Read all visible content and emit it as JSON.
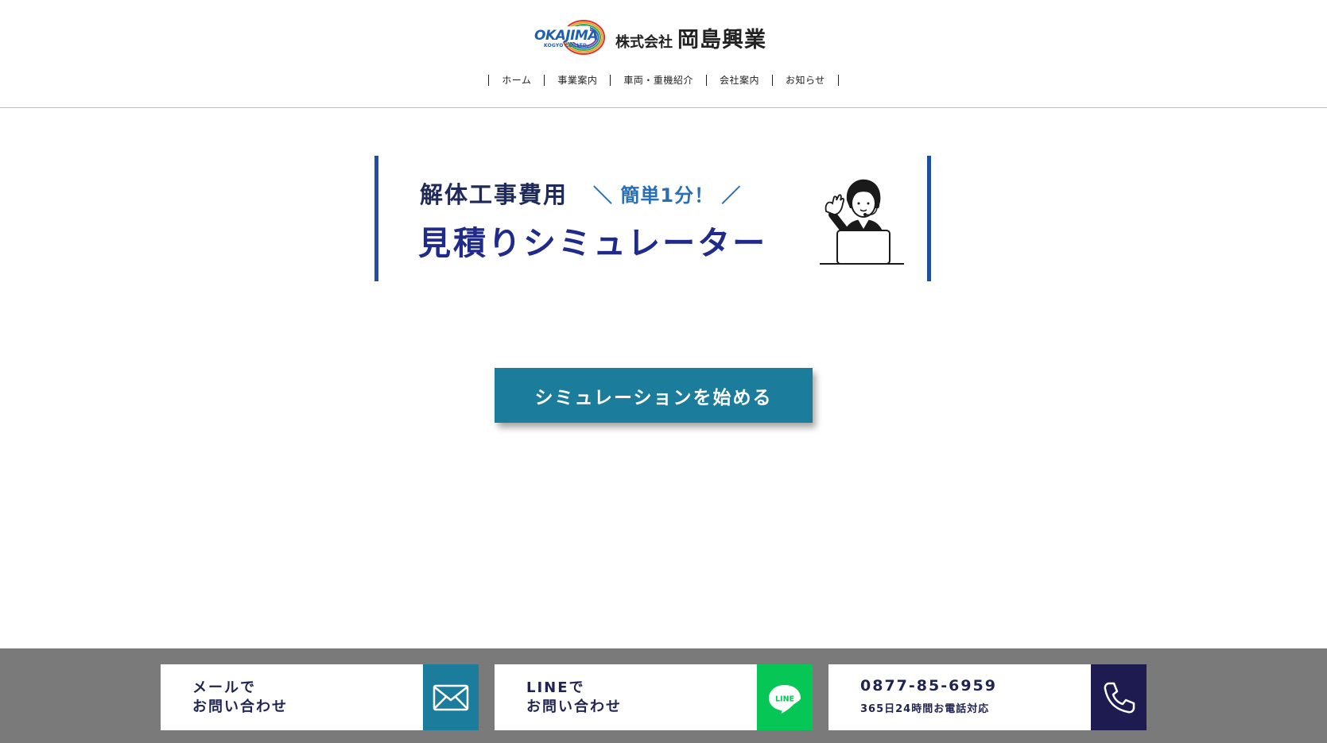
{
  "header": {
    "logo": {
      "wordmark": "OKAJIMA",
      "submark": "KOGYO CO.,LTD.",
      "prefix": "株式会社",
      "name": "岡島興業"
    },
    "nav": [
      {
        "label": "ホーム"
      },
      {
        "label": "事業案内"
      },
      {
        "label": "車両・重機紹介"
      },
      {
        "label": "会社案内"
      },
      {
        "label": "お知らせ"
      }
    ]
  },
  "banner": {
    "title1": "解体工事費用",
    "tag": "＼ 簡単1分！ ／",
    "title2": "見積りシミュレーター",
    "illustration_icon": "operator-with-headset-laptop-icon"
  },
  "cta": {
    "label": "シミュレーションを始める"
  },
  "footer": {
    "mail": {
      "line1": "メールで",
      "line2": "お問い合わせ",
      "icon": "envelope-icon"
    },
    "line": {
      "line1": "LINEで",
      "line2": "お問い合わせ",
      "icon": "line-app-icon",
      "icon_text": "LINE"
    },
    "phone": {
      "number": "0877-85-6959",
      "note": "365日24時間お電話対応",
      "icon": "phone-icon"
    }
  },
  "colors": {
    "accent_teal": "#1b7c9c",
    "banner_blue": "#1f4fa3",
    "title_navy": "#1f2a8a",
    "line_green": "#06c755",
    "phone_navy": "#1e1b50",
    "footer_gray": "#7a7a7a"
  }
}
